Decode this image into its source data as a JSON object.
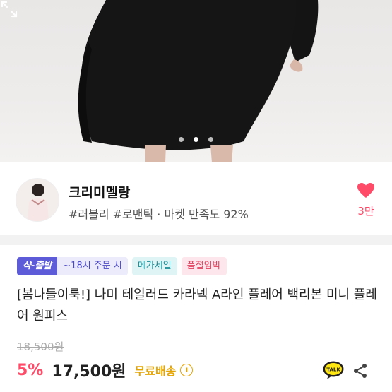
{
  "seller": {
    "name": "크리미멜랑",
    "tags": "#러블리 #로맨틱 · 마켓 만족도 92%",
    "likes": "3만"
  },
  "badges": {
    "delivery_main": "샥-출발",
    "delivery_sub": "~18시 주문 시",
    "mega": "메가세일",
    "soldout": "품절임박"
  },
  "product": {
    "title": "[봄나들이룩!] 나미 테일러드 카라넥 A라인 플레어 백리본 미니 플레어 원피스",
    "original_price": "18,500원",
    "discount": "5%",
    "price": "17,500원",
    "shipping": "무료배송"
  },
  "icons": {
    "talk_label": "TALK"
  },
  "gallery": {
    "count": 3,
    "active_index": 1
  }
}
